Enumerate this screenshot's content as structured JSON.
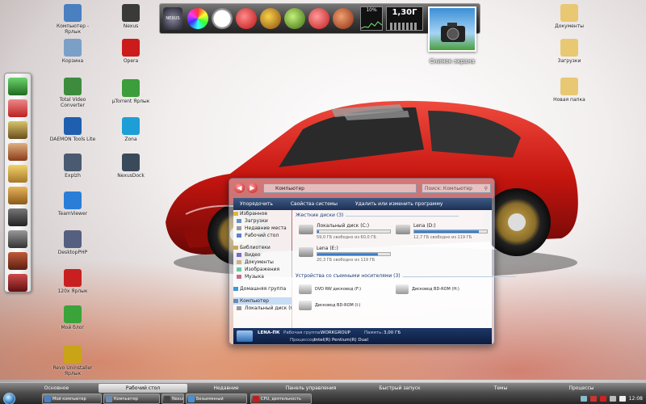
{
  "desktop": {
    "icons_left": [
      {
        "label": "Компьютер - Ярлык",
        "icon": "computer-icon",
        "color": "#4a7fc0"
      },
      {
        "label": "Корзина",
        "icon": "recycle-bin-icon",
        "color": "#7aa0c8"
      },
      {
        "label": "Total Video Converter",
        "icon": "video-converter-icon",
        "color": "#3d8c3d"
      },
      {
        "label": "DAEMON Tools Lite",
        "icon": "daemon-tools-icon",
        "color": "#1e5fb0"
      },
      {
        "label": "Explzh",
        "icon": "archive-icon",
        "color": "#4a5a70"
      },
      {
        "label": "TeamViewer",
        "icon": "teamviewer-icon",
        "color": "#2a7ed8"
      },
      {
        "label": "DesktopPHP",
        "icon": "php-icon",
        "color": "#555f80"
      },
      {
        "label": "120x Ярлык",
        "icon": "dvd-icon",
        "color": "#c82020"
      },
      {
        "label": "Мой блог",
        "icon": "green-box-icon",
        "color": "#3aa33a"
      },
      {
        "label": "Revo Uninstaller Ярлык",
        "icon": "revo-icon",
        "color": "#c9a417"
      }
    ],
    "icons_second": [
      {
        "label": "Nexus",
        "icon": "nexus-icon",
        "color": "#3a3a3a"
      },
      {
        "label": "Opera",
        "icon": "opera-icon",
        "color": "#cc1b1b"
      },
      {
        "label": "µTorrent Ярлык",
        "icon": "utorrent-icon",
        "color": "#3c9d3c"
      },
      {
        "label": "Zona",
        "icon": "zona-icon",
        "color": "#1e9ed6"
      },
      {
        "label": "NexusDock",
        "icon": "nexus-dock-icon",
        "color": "#3a4a5a"
      }
    ],
    "icons_right": [
      {
        "label": "Документы",
        "icon": "folder-icon",
        "color": "#e8c872"
      },
      {
        "label": "Загрузки",
        "icon": "folder-icon",
        "color": "#e8c872"
      },
      {
        "label": "Новая папка",
        "icon": "folder-icon",
        "color": "#e8c872"
      }
    ],
    "screenshot_label": "Снимок экрана"
  },
  "top_dock": {
    "logo_text": "NEXUS",
    "cpu_percent": "10%",
    "memory": "1,30Г"
  },
  "explorer": {
    "address": "Компьютер",
    "search_placeholder": "Поиск: Компьютер",
    "toolbar": [
      "Упорядочить",
      "Свойства системы",
      "Удалить или изменить программу"
    ],
    "nav": [
      {
        "label": "Избранное",
        "header": true,
        "color": "#e3b43c"
      },
      {
        "label": "Загрузки",
        "color": "#6a8fc8"
      },
      {
        "label": "Недавние места",
        "color": "#9a9a9a"
      },
      {
        "label": "Рабочий стол",
        "color": "#5a82c8"
      },
      {
        "gap": true
      },
      {
        "label": "Библиотеки",
        "header": true,
        "color": "#c8a65c"
      },
      {
        "label": "Видео",
        "color": "#7a6ac8"
      },
      {
        "label": "Документы",
        "color": "#c8b48a"
      },
      {
        "label": "Изображения",
        "color": "#6ac8a0"
      },
      {
        "label": "Музыка",
        "color": "#c86a8a"
      },
      {
        "gap": true
      },
      {
        "label": "Домашняя группа",
        "header": true,
        "color": "#3a9ad6"
      },
      {
        "gap": true
      },
      {
        "label": "Компьютер",
        "header": true,
        "selected": true,
        "color": "#6a8ab0"
      },
      {
        "label": "Локальный диск (C:",
        "color": "#999"
      }
    ],
    "section_hdd": "Жесткие диски (3)",
    "drives": [
      {
        "name": "Локальный диск (C:)",
        "free": "59,0 ГБ свободно из 60,0 ГБ",
        "fill": 0.02
      },
      {
        "name": "Lena (D:)",
        "free": "12,7 ГБ свободно из 119 ГБ",
        "fill": 0.89
      },
      {
        "name": "Lena (E:)",
        "free": "20,3 ГБ свободно из 119 ГБ",
        "fill": 0.83
      }
    ],
    "section_removable": "Устройства со съемными носителями (3)",
    "removable": [
      "DVD RW дисковод (F:)",
      "Дисковод BD-ROM (H:)",
      "Дисковод BD-ROM (I:)"
    ],
    "status": {
      "pc_name": "LENA-ПК",
      "workgroup_label": "Рабочая группа:",
      "workgroup": "WORKGROUP",
      "memory_label": "Память:",
      "memory": "3,00 ГБ",
      "cpu_label": "Процессор:",
      "cpu": "Intel(R) Pentium(R) Dual"
    }
  },
  "taskbar": {
    "tabs": [
      "Основное",
      "Рабочий стол",
      "Недавние",
      "Панель управления",
      "Быстрый запуск",
      "Темы",
      "Процессы"
    ],
    "buttons": [
      {
        "label": "Мой компьютер",
        "color": "#4a7fc0"
      },
      {
        "label": "Компьютер",
        "color": "#6a8ab0"
      },
      {
        "label": "Nexus",
        "color": "#444"
      },
      {
        "label": "Безымянный",
        "color": "#4a8fd0"
      },
      {
        "label": "CPU, деятельность",
        "color": "#c01e1e"
      }
    ],
    "clock": "12:08"
  }
}
